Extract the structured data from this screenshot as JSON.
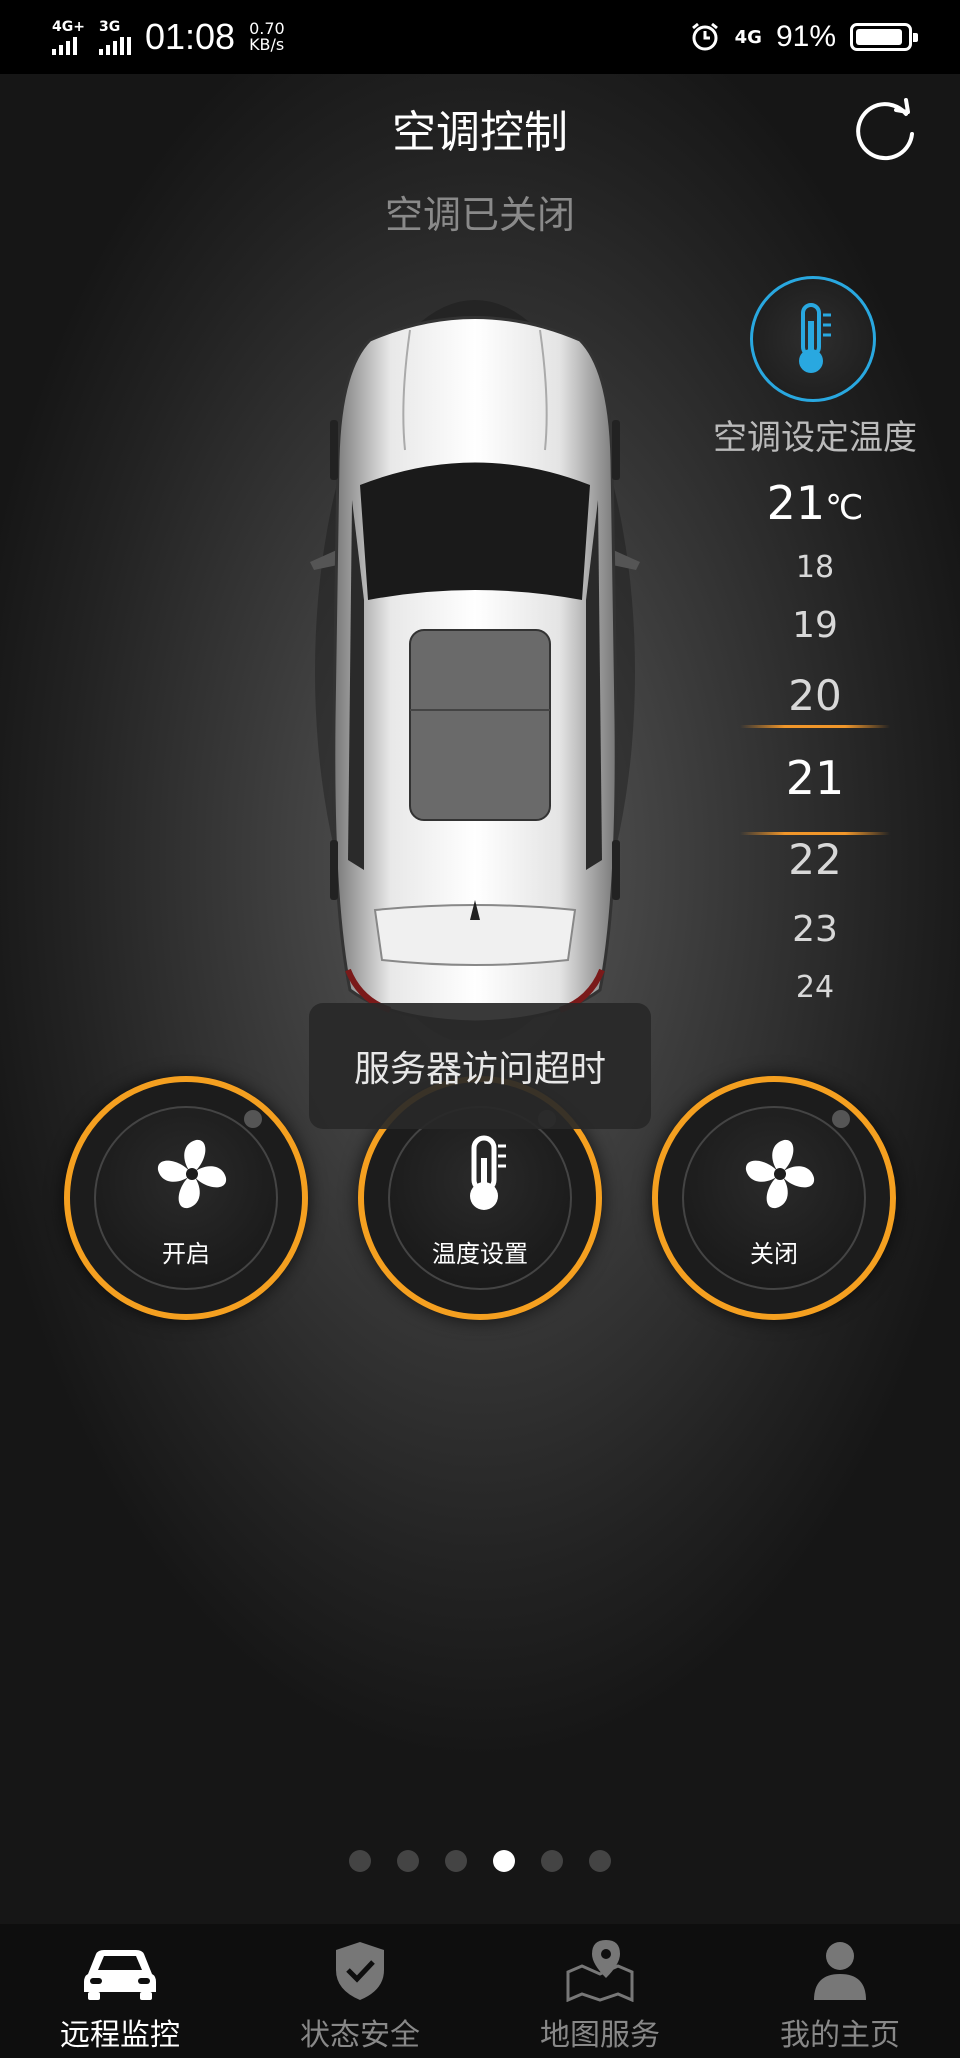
{
  "status_bar": {
    "sim1_network": "4G+",
    "sim2_network": "3G",
    "time": "01:08",
    "speed_value": "0.70",
    "speed_unit": "KB/s",
    "network_right": "4G",
    "battery_percent": "91%",
    "battery_level": 0.91
  },
  "header": {
    "title": "空调控制",
    "status": "空调已关闭"
  },
  "temperature": {
    "label": "空调设定温度",
    "current_value": "21",
    "unit": "℃",
    "picker_values": [
      "18",
      "19",
      "20",
      "21",
      "22",
      "23",
      "24"
    ],
    "selected": "21"
  },
  "controls": {
    "on_label": "开启",
    "temp_label": "温度设置",
    "off_label": "关闭"
  },
  "toast": {
    "message": "服务器访问超时"
  },
  "pager": {
    "count": 6,
    "active_index": 3
  },
  "bottom_nav": {
    "items": [
      {
        "label": "远程监控",
        "icon": "car-icon",
        "active": true
      },
      {
        "label": "状态安全",
        "icon": "shield-check-icon",
        "active": false
      },
      {
        "label": "地图服务",
        "icon": "map-pin-icon",
        "active": false
      },
      {
        "label": "我的主页",
        "icon": "user-icon",
        "active": false
      }
    ]
  },
  "colors": {
    "accent_orange": "#f5a020",
    "thermo_blue": "#29a8e0"
  }
}
